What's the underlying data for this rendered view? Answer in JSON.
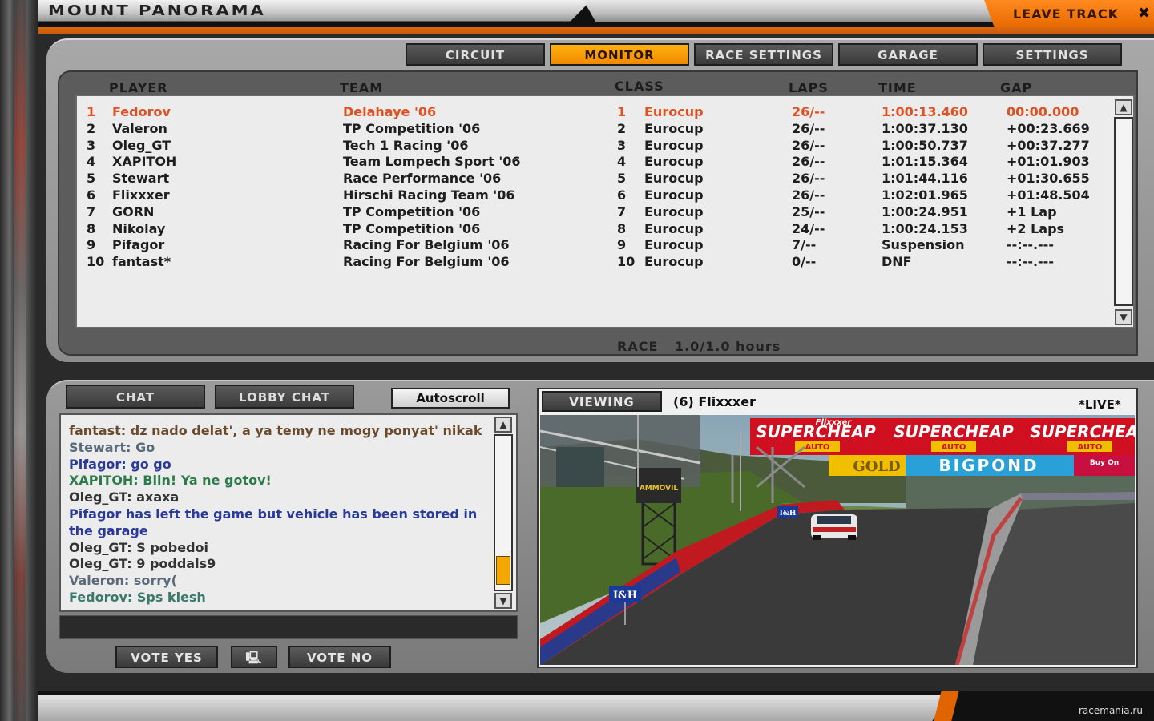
{
  "header": {
    "track_name": "MOUNT PANORAMA",
    "leave_label": "LEAVE TRACK",
    "close_glyph": "✖"
  },
  "tabs": [
    {
      "label": "CIRCUIT",
      "active": false
    },
    {
      "label": "MONITOR",
      "active": true
    },
    {
      "label": "RACE SETTINGS",
      "active": false
    },
    {
      "label": "GARAGE",
      "active": false
    },
    {
      "label": "SETTINGS",
      "active": false
    }
  ],
  "standings": {
    "columns": {
      "player": "PLAYER",
      "team": "TEAM",
      "class": "CLASS",
      "laps": "LAPS",
      "time": "TIME",
      "gap": "GAP"
    },
    "rows": [
      {
        "pos": "1",
        "player": "Fedorov",
        "team": "Delahaye '06",
        "cpos": "1",
        "class": "Eurocup",
        "laps": "26/--",
        "time": "1:00:13.460",
        "gap": "00:00.000"
      },
      {
        "pos": "2",
        "player": "Valeron",
        "team": "TP Competition '06",
        "cpos": "2",
        "class": "Eurocup",
        "laps": "26/--",
        "time": "1:00:37.130",
        "gap": "+00:23.669"
      },
      {
        "pos": "3",
        "player": "Oleg_GT",
        "team": "Tech 1 Racing '06",
        "cpos": "3",
        "class": "Eurocup",
        "laps": "26/--",
        "time": "1:00:50.737",
        "gap": "+00:37.277"
      },
      {
        "pos": "4",
        "player": "XAPITOH",
        "team": "Team Lompech Sport '06",
        "cpos": "4",
        "class": "Eurocup",
        "laps": "26/--",
        "time": "1:01:15.364",
        "gap": "+01:01.903"
      },
      {
        "pos": "5",
        "player": "Stewart",
        "team": "Race Performance '06",
        "cpos": "5",
        "class": "Eurocup",
        "laps": "26/--",
        "time": "1:01:44.116",
        "gap": "+01:30.655"
      },
      {
        "pos": "6",
        "player": "Flixxxer",
        "team": "Hirschi Racing Team '06",
        "cpos": "6",
        "class": "Eurocup",
        "laps": "26/--",
        "time": "1:02:01.965",
        "gap": "+01:48.504"
      },
      {
        "pos": "7",
        "player": "GORN",
        "team": "TP Competition '06",
        "cpos": "7",
        "class": "Eurocup",
        "laps": "25/--",
        "time": "1:00:24.951",
        "gap": "+1 Lap"
      },
      {
        "pos": "8",
        "player": "Nikolay",
        "team": "TP Competition '06",
        "cpos": "8",
        "class": "Eurocup",
        "laps": "24/--",
        "time": "1:00:24.153",
        "gap": "+2 Laps"
      },
      {
        "pos": "9",
        "player": "Pifagor",
        "team": "Racing For Belgium '06",
        "cpos": "9",
        "class": "Eurocup",
        "laps": "7/--",
        "time": "Suspension",
        "gap": "--:--.---"
      },
      {
        "pos": "10",
        "player": "fantast*",
        "team": "Racing For Belgium '06",
        "cpos": "10",
        "class": "Eurocup",
        "laps": "0/--",
        "time": "DNF",
        "gap": "--:--.---"
      }
    ],
    "race_label": "RACE",
    "race_duration": "1.0/1.0 hours"
  },
  "chat": {
    "tab_chat": "CHAT",
    "tab_lobby": "LOBBY CHAT",
    "autoscroll": "Autoscroll",
    "lines": [
      {
        "text": "fantast: dz nado delat', a ya temy ne mogy ponyat' nikak",
        "color": "#6a4a2a"
      },
      {
        "text": "Stewart: Go",
        "color": "#5a6a7a"
      },
      {
        "text": "Pifagor: go go",
        "color": "#2a3a9a"
      },
      {
        "text": "XAPITOH: Blin! Ya ne gotov!",
        "color": "#2a7a4a"
      },
      {
        "text": "Oleg_GT: axaxa",
        "color": "#333333"
      },
      {
        "text": "Pifagor has left the game but vehicle has been stored in",
        "color": "#2a3a9a"
      },
      {
        "text": "the garage",
        "color": "#2a3a9a"
      },
      {
        "text": "Oleg_GT: S pobedoi",
        "color": "#333333"
      },
      {
        "text": "Oleg_GT: 9 poddals9",
        "color": "#333333"
      },
      {
        "text": "Valeron: sorry(",
        "color": "#5a6a7a"
      },
      {
        "text": "Fedorov: Sps klesh",
        "color": "#3a7a6a"
      }
    ],
    "vote_yes": "VOTE YES",
    "vote_no": "VOTE NO",
    "monitor_glyph": "🖳"
  },
  "viewer": {
    "viewing_label": "VIEWING",
    "viewing_name": "(6) Flixxxer",
    "live_label": "*LIVE*",
    "car_tag": "Flixxxer",
    "banner1": "SUPERCHEAP",
    "banner1b": "AUTO",
    "gold": "GOLD",
    "bigpond": "BIGPOND",
    "buy": "Buy On",
    "ih": "I&H",
    "ih2": "I&H",
    "tower": "AMMOVIL"
  },
  "footer": {
    "credit": "racemania.ru"
  }
}
